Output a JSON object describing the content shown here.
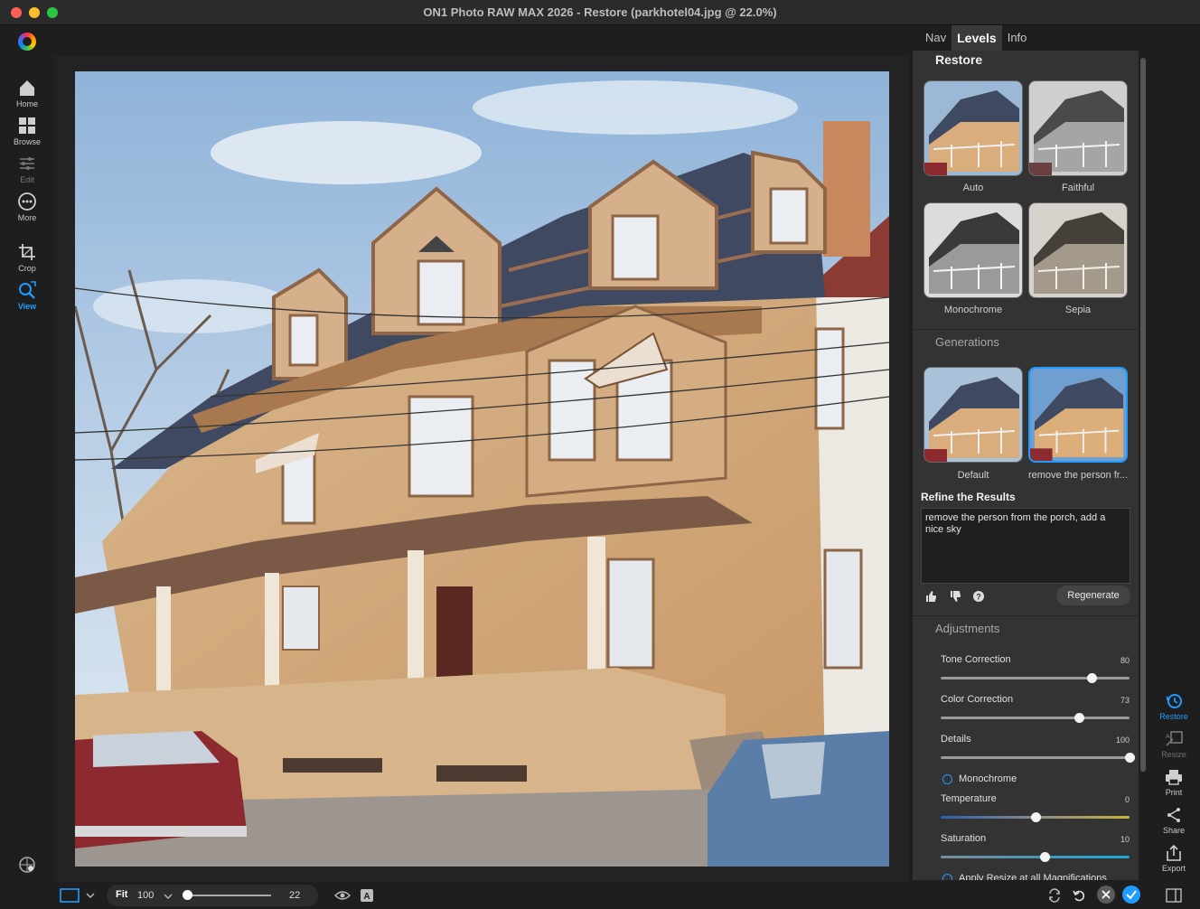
{
  "window": {
    "title": "ON1 Photo RAW MAX 2026 - Restore (parkhotel04.jpg @ 22.0%)"
  },
  "tabs": [
    {
      "label": "Nav",
      "active": false
    },
    {
      "label": "Levels",
      "active": true
    },
    {
      "label": "Info",
      "active": false
    }
  ],
  "left_nav": [
    {
      "label": "Home",
      "icon": "home-icon"
    },
    {
      "label": "Browse",
      "icon": "grid-icon"
    },
    {
      "label": "Edit",
      "icon": "sliders-icon",
      "state": "disabled"
    },
    {
      "label": "More",
      "icon": "more-icon"
    },
    {
      "label": "Crop",
      "icon": "crop-icon"
    },
    {
      "label": "View",
      "icon": "view-icon",
      "state": "active"
    }
  ],
  "restore": {
    "title": "Restore",
    "presets": [
      {
        "label": "Auto",
        "style": "color"
      },
      {
        "label": "Faithful",
        "style": "gray"
      },
      {
        "label": "Monochrome",
        "style": "mono"
      },
      {
        "label": "Sepia",
        "style": "sepia"
      }
    ],
    "generations_title": "Generations",
    "generations": [
      {
        "label": "Default",
        "selected": false
      },
      {
        "label": "remove the person fr...",
        "selected": true
      }
    ],
    "refine_title": "Refine the Results",
    "refine_text": "remove the person from the porch, add a nice sky",
    "regenerate_label": "Regenerate"
  },
  "adjustments": {
    "title": "Adjustments",
    "sliders": [
      {
        "label": "Tone Correction",
        "value": 80,
        "min": 0,
        "max": 100
      },
      {
        "label": "Color Correction",
        "value": 73,
        "min": 0,
        "max": 100
      },
      {
        "label": "Details",
        "value": 100,
        "min": 0,
        "max": 100
      }
    ],
    "monochrome_label": "Monochrome",
    "temperature": {
      "label": "Temperature",
      "value": 0,
      "min": -100,
      "max": 100
    },
    "saturation": {
      "label": "Saturation",
      "value": 10,
      "min": -100,
      "max": 100
    },
    "apply_resize_label": "Apply Resize at all Magnifications"
  },
  "right_tools": [
    {
      "label": "Restore",
      "icon": "restore-icon",
      "state": "active"
    },
    {
      "label": "Resize",
      "icon": "resize-icon",
      "state": "disabled"
    },
    {
      "label": "Print",
      "icon": "print-icon"
    },
    {
      "label": "Share",
      "icon": "share-icon"
    },
    {
      "label": "Export",
      "icon": "export-icon"
    }
  ],
  "bottom": {
    "fit_label": "Fit",
    "fit_value": "100",
    "zoom_value": "22",
    "zoom_fraction": 0.0
  },
  "colors": {
    "accent": "#1e9cff",
    "panel": "#333333",
    "background": "#1e1e1e"
  }
}
